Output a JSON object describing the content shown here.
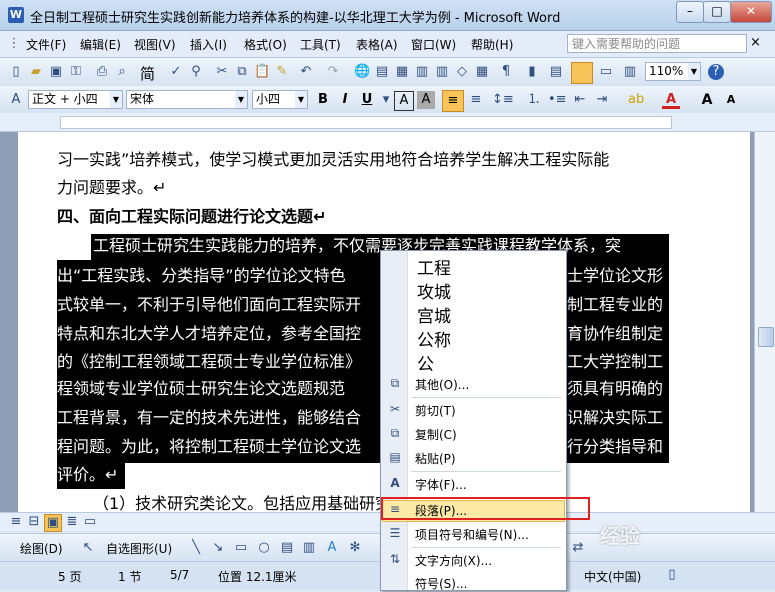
{
  "window": {
    "title": "全日制工程硕士研究生实践创新能力培养体系的构建-以华北理工大学为例 - Microsoft Word",
    "app_icon": "W",
    "minimize": "–",
    "maximize": "□",
    "close": "✕"
  },
  "menu": {
    "items": [
      "文件(F)",
      "编辑(E)",
      "视图(V)",
      "插入(I)",
      "格式(O)",
      "工具(T)",
      "表格(A)",
      "窗口(W)",
      "帮助(H)"
    ],
    "help_placeholder": "键入需要帮助的问题",
    "help_close": "×"
  },
  "toolbar": {
    "font_simplify": "简",
    "zoom": "110%"
  },
  "format_bar": {
    "style": "正文 + 小四",
    "font": "宋体",
    "size": "小四",
    "bold": "B",
    "italic": "I",
    "underline": "U",
    "char_border": "A",
    "char_shade": "A",
    "font_color": "A",
    "grow_font": "A",
    "shrink_font": "A"
  },
  "document": {
    "lines": [
      "习一实践”培养模式，使学习模式更加灵活实用地符合培养学生解决工程实际能",
      "力问题要求。↵",
      "四、面向工程实际问题进行论文选题↵",
      "工程硕士研究生实践能力的培养，不仅需要逐步完善实践课程教学体系，突",
      "出“工程实践、分类指导”的学位论文特色",
      "式较单一，不利于引导他们面向工程实际开",
      "特点和东北大学人才培养定位，参考全国控",
      "的《控制工程领域工程硕士专业学位标准》",
      "程领域专业学位硕士研究生论文选题规范",
      "工程背景，有一定的技术先进性，能够结合",
      "程问题。为此，将控制工程硕士学位论文选",
      "评价。↵",
      "（1）技术研究类论文。包括应用基础研究、应用研究、实验研究。"
    ],
    "right_fragments": [
      "士学位论文形",
      "制工程专业的",
      "育协作组制定",
      "工大学控制工",
      "须具有明确的",
      "识解决实际工",
      "行分类指导和"
    ]
  },
  "context_menu": {
    "candidates": [
      "工程",
      "攻城",
      "宫城",
      "公称",
      "公"
    ],
    "items": [
      "其他(O)...",
      "剪切(T)",
      "复制(C)",
      "粘贴(P)",
      "字体(F)...",
      "段落(P)...",
      "项目符号和编号(N)...",
      "文字方向(X)...",
      "符号(S)..."
    ],
    "highlighted": "段落(P)..."
  },
  "drawing_bar": {
    "draw": "绘图(D)",
    "autoshapes": "自选图形(U)"
  },
  "status": {
    "page": "5 页",
    "section": "1 节",
    "pages": "5/7",
    "position": "位置 12.1厘米",
    "language": "中文(中国)"
  },
  "watermark": "经验"
}
